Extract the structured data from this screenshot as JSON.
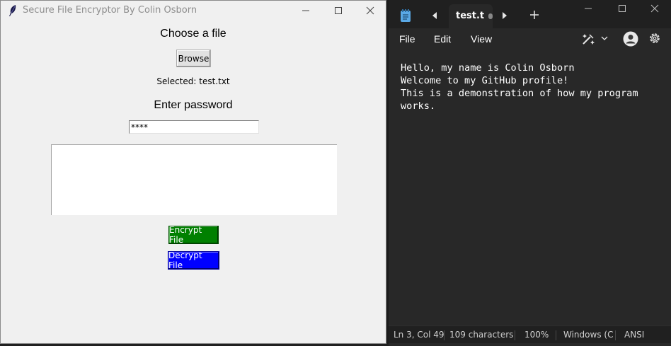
{
  "tk_window": {
    "title": "Secure File Encryptor By Colin Osborn",
    "choose_label": "Choose a file",
    "browse_label": "Browse",
    "selected_text": "Selected: test.txt",
    "password_label": "Enter password",
    "password_value": "****",
    "output_text": "",
    "encrypt_label": "Encrypt File",
    "decrypt_label": "Decrypt File",
    "encrypt_color": "#008000",
    "decrypt_color": "#0000ff",
    "icons": [
      "feather-icon",
      "minimize-icon",
      "maximize-icon",
      "close-icon"
    ]
  },
  "notepad": {
    "tab_label": "test.tx",
    "menu": [
      "File",
      "Edit",
      "View"
    ],
    "lines": [
      "Hello, my name is Colin Osborn",
      "Welcome to my GitHub profile!",
      "This is a demonstration of how my program",
      "works."
    ],
    "status": {
      "position": "Ln 3, Col 49",
      "characters": "109 characters",
      "zoom": "100%",
      "line_ending": "Windows (CRLF)",
      "encoding": "ANSI"
    },
    "icons": [
      "notepad-icon",
      "tab-prev-icon",
      "tab-next-icon",
      "add-tab-icon",
      "copilot-icon",
      "chevron-down-icon",
      "account-icon",
      "settings-icon",
      "minimize-icon",
      "maximize-icon",
      "close-icon"
    ]
  }
}
